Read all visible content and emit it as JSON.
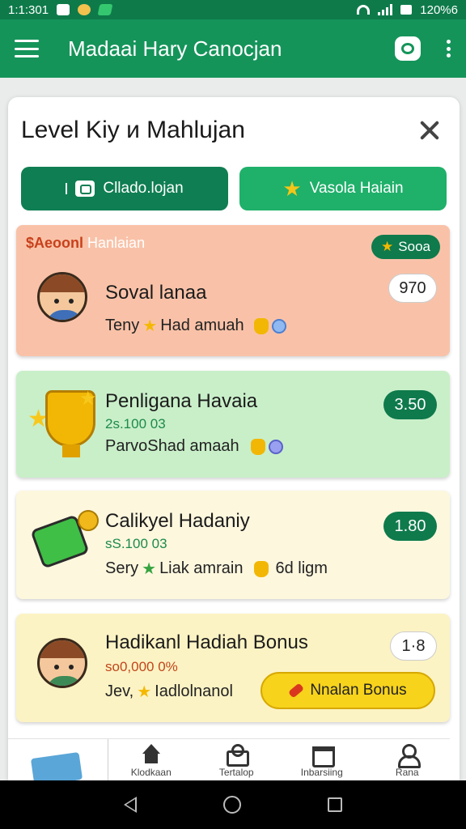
{
  "status_bar": {
    "time": "1:1:301",
    "battery": "120%6"
  },
  "app_bar": {
    "title": "Madaai Hary Canocjan"
  },
  "dialog": {
    "title": "Level Kiy и Mahlujan",
    "tabs": [
      {
        "label": "Cllado.lojan"
      },
      {
        "label": "Vasola Haiain"
      }
    ]
  },
  "cards": [
    {
      "label_prefix": "$Aeoonl",
      "label_suffix": "Hanlaian",
      "badge": "Sooa",
      "name": "Soval lanaa",
      "value": "970",
      "desc": "Teny",
      "desc_rest": "Had amuah",
      "color": "#f9c2a8"
    },
    {
      "name": "Penligana Havaia",
      "amount": "2ѕ.100 03",
      "desc": "ParvoShad amaah",
      "value": "3.50",
      "color": "#c9efc9"
    },
    {
      "name": "Calikyel Hadaniy",
      "amount": "ѕS.100 03",
      "desc": "Sery",
      "desc_rest": "Liak amrain",
      "desc_extra": "6d ligm",
      "value": "1.80",
      "color": "#fdf7de"
    },
    {
      "name": "Hadikanl Hadiah Bonus",
      "amount": "ѕo0,000 0%",
      "desc": "Jev,",
      "desc_rest": "Iadlolnanol",
      "value": "1·8",
      "button": "Nnalan Bonus",
      "color": "#fcf3c4"
    }
  ],
  "bottom_nav": [
    {
      "label": "Klodkaan",
      "icon": "home-icon"
    },
    {
      "label": "Tertalop",
      "icon": "basket-icon"
    },
    {
      "label": "Inbarsiing",
      "icon": "calendar-icon"
    },
    {
      "label": "Rana",
      "icon": "user-icon"
    }
  ],
  "colors": {
    "primary": "#15945a",
    "primary_dark": "#0e7a4a",
    "accent_yellow": "#f7d31c"
  }
}
